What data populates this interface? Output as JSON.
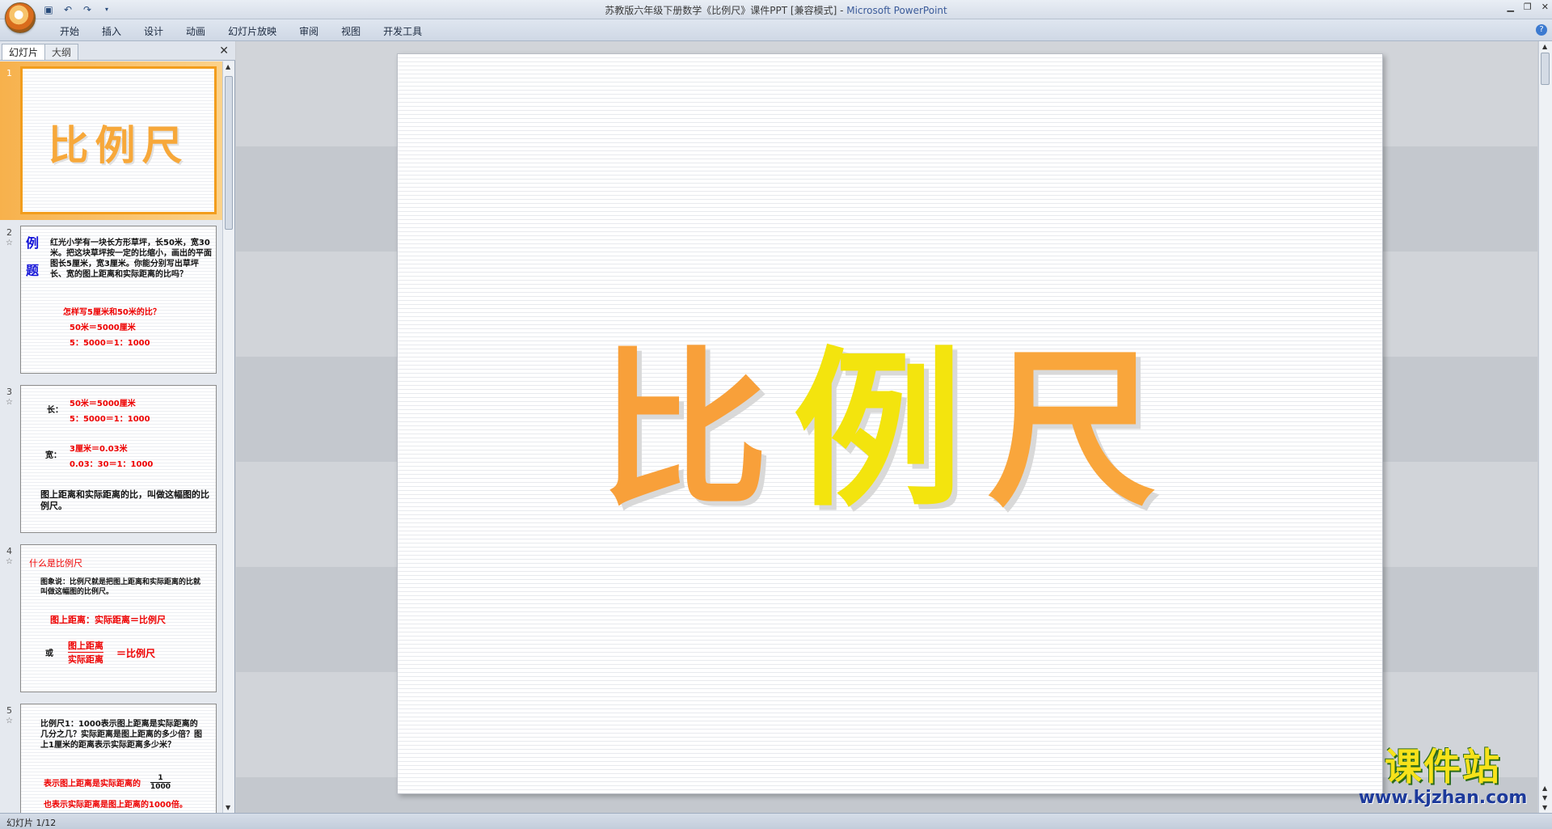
{
  "window": {
    "title_doc": "苏教版六年级下册数学《比例尺》课件PPT [兼容模式]",
    "title_sep": " - ",
    "title_app": "Microsoft PowerPoint"
  },
  "ribbon": {
    "tabs": [
      "开始",
      "插入",
      "设计",
      "动画",
      "幻灯片放映",
      "审阅",
      "视图",
      "开发工具"
    ]
  },
  "left_pane": {
    "tab_slides": "幻灯片",
    "tab_outline": "大纲",
    "close": "✕"
  },
  "thumbnails": [
    {
      "num": "1",
      "title": "比例尺"
    },
    {
      "num": "2",
      "star": "☆",
      "label": "例题",
      "body": "红光小学有一块长方形草坪，长50米，宽30米。把这块草坪按一定的比缩小，画出的平面图长5厘米，宽3厘米。你能分别写出草坪长、宽的图上距离和实际距离的比吗？",
      "question": "怎样写5厘米和50米的比？",
      "line1": "50米＝5000厘米",
      "line2": "5：5000＝1：1000"
    },
    {
      "num": "3",
      "star": "☆",
      "len_label": "长：",
      "len1": "50米＝5000厘米",
      "len2": "5：5000＝1：1000",
      "wid_label": "宽：",
      "wid1": "3厘米＝0.03米",
      "wid2": "0.03：30＝1：1000",
      "def": "图上距离和实际距离的比，叫做这幅图的比例尺。"
    },
    {
      "num": "4",
      "star": "☆",
      "heading": "什么是比例尺",
      "body": "图象说：比例尺就是把图上距离和实际距离的比就叫做这幅图的比例尺。",
      "formula": "图上距离：实际距离＝比例尺",
      "or": "或",
      "frac_top": "图上距离",
      "frac_bottom": "实际距离",
      "eq": "＝比例尺"
    },
    {
      "num": "5",
      "star": "☆",
      "body": "比例尺1：1000表示图上距离是实际距离的几分之几？实际距离是图上距离的多少倍？图上1厘米的距离表示实际距离多少米？",
      "line1": "表示图上距离是实际距离的",
      "frac_top": "1",
      "frac_bottom": "1000",
      "line2": "也表示实际距离是图上距离的1000倍。"
    }
  ],
  "slide": {
    "title_chars": [
      "比",
      "例",
      "尺"
    ]
  },
  "status": {
    "text": "幻灯片 1/12"
  },
  "watermark": {
    "brand": "课件站",
    "url": "www.kjzhan.com"
  },
  "colors": {
    "selection": "#f29d1d",
    "title_orange": "#f8a03a",
    "title_yellow": "#f3e40e",
    "red_text": "#e00000",
    "blue_text": "#1313d8"
  }
}
